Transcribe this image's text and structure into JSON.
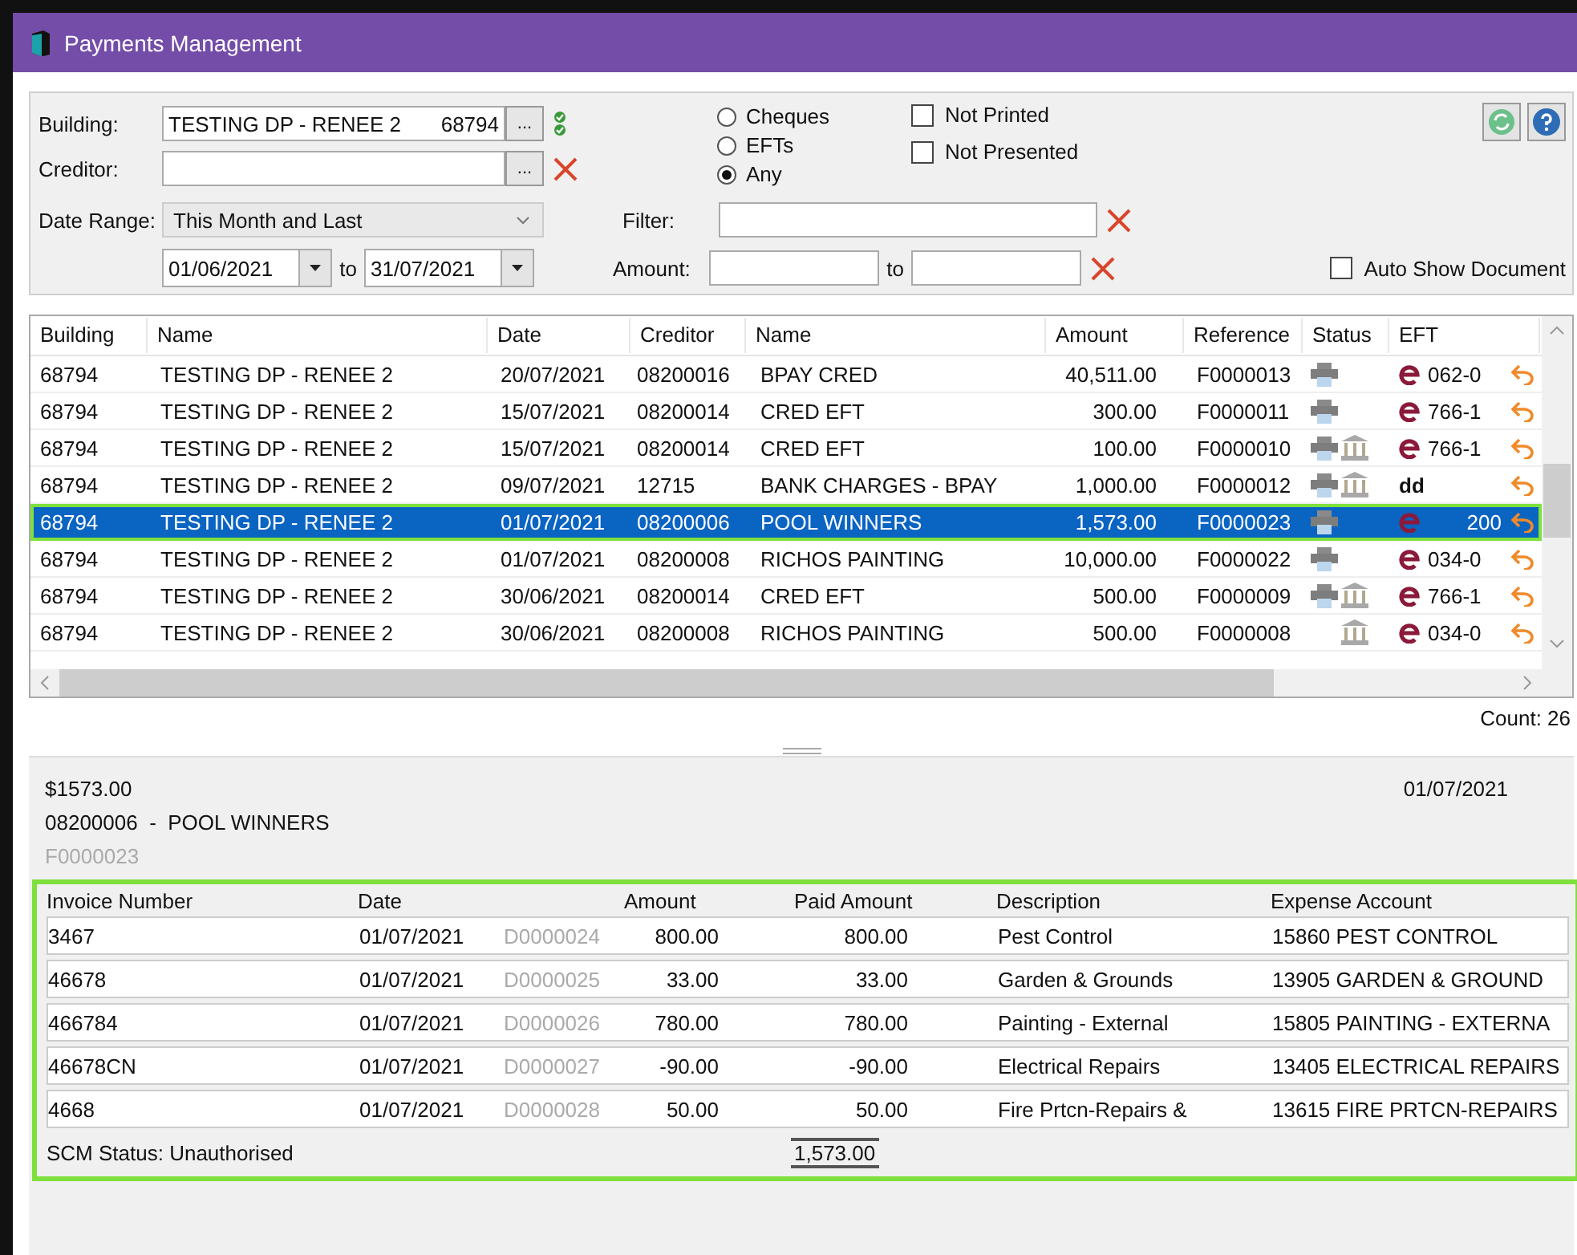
{
  "window": {
    "title": "Payments Management"
  },
  "filters": {
    "building": {
      "label": "Building:",
      "value": "TESTING DP - RENEE 2",
      "code": "68794",
      "button": "...",
      "verified": true
    },
    "creditor": {
      "label": "Creditor:",
      "button": "..."
    },
    "date_range": {
      "label": "Date Range:",
      "value": "This Month and Last",
      "from": "01/06/2021",
      "to_label": "to",
      "to": "31/07/2021"
    },
    "payment_type": [
      {
        "label": "Cheques",
        "selected": false
      },
      {
        "label": "EFTs",
        "selected": false
      },
      {
        "label": "Any",
        "selected": true
      }
    ],
    "flags": [
      {
        "label": "Not Printed",
        "checked": false
      },
      {
        "label": "Not Presented",
        "checked": false
      }
    ],
    "filter": {
      "label": "Filter:"
    },
    "amount": {
      "label": "Amount:",
      "to_label": "to"
    },
    "auto_show": {
      "label": "Auto Show Document",
      "checked": false
    }
  },
  "payments": {
    "columns": [
      "Building",
      "Name",
      "Date",
      "Creditor",
      "Name",
      "Amount",
      "Reference",
      "Status",
      "EFT"
    ],
    "rows": [
      {
        "building": "68794",
        "name": "TESTING DP - RENEE 2",
        "date": "20/07/2021",
        "creditor": "08200016",
        "creditor_name": "BPAY CRED",
        "amount": "40,511.00",
        "reference": "F0000013",
        "printed": true,
        "banked": false,
        "kind": "eft",
        "eft": "062-0",
        "selected": false
      },
      {
        "building": "68794",
        "name": "TESTING DP - RENEE 2",
        "date": "15/07/2021",
        "creditor": "08200014",
        "creditor_name": "CRED EFT",
        "amount": "300.00",
        "reference": "F0000011",
        "printed": true,
        "banked": false,
        "kind": "eft",
        "eft": "766-1",
        "selected": false
      },
      {
        "building": "68794",
        "name": "TESTING DP - RENEE 2",
        "date": "15/07/2021",
        "creditor": "08200014",
        "creditor_name": "CRED EFT",
        "amount": "100.00",
        "reference": "F0000010",
        "printed": true,
        "banked": true,
        "kind": "eft",
        "eft": "766-1",
        "selected": false
      },
      {
        "building": "68794",
        "name": "TESTING DP - RENEE 2",
        "date": "09/07/2021",
        "creditor": "12715",
        "creditor_name": "BANK CHARGES - BPAY",
        "amount": "1,000.00",
        "reference": "F0000012",
        "printed": true,
        "banked": true,
        "kind": "direct_debit",
        "eft": "dd",
        "selected": false
      },
      {
        "building": "68794",
        "name": "TESTING DP - RENEE 2",
        "date": "01/07/2021",
        "creditor": "08200006",
        "creditor_name": "POOL WINNERS",
        "amount": "1,573.00",
        "reference": "F0000023",
        "printed": true,
        "banked": false,
        "kind": "eft",
        "eft": "200",
        "selected": true
      },
      {
        "building": "68794",
        "name": "TESTING DP - RENEE 2",
        "date": "01/07/2021",
        "creditor": "08200008",
        "creditor_name": "RICHOS PAINTING",
        "amount": "10,000.00",
        "reference": "F0000022",
        "printed": true,
        "banked": false,
        "kind": "eft",
        "eft": "034-0",
        "selected": false
      },
      {
        "building": "68794",
        "name": "TESTING DP - RENEE 2",
        "date": "30/06/2021",
        "creditor": "08200014",
        "creditor_name": "CRED EFT",
        "amount": "500.00",
        "reference": "F0000009",
        "printed": true,
        "banked": true,
        "kind": "eft",
        "eft": "766-1",
        "selected": false
      },
      {
        "building": "68794",
        "name": "TESTING DP - RENEE 2",
        "date": "30/06/2021",
        "creditor": "08200008",
        "creditor_name": "RICHOS PAINTING",
        "amount": "500.00",
        "reference": "F0000008",
        "printed": false,
        "banked": true,
        "kind": "eft",
        "eft": "034-0",
        "selected": false
      }
    ],
    "count": "Count: 26"
  },
  "detail": {
    "amount": "$1573.00",
    "creditor": "08200006  -  POOL WINNERS",
    "reference": "F0000023",
    "date": "01/07/2021",
    "columns": [
      "Invoice Number",
      "Date",
      "Amount",
      "Paid Amount",
      "Description",
      "Expense Account"
    ],
    "invoices": [
      {
        "invoice": "3467",
        "date": "01/07/2021",
        "doc": "D0000024",
        "amount": "800.00",
        "paid": "800.00",
        "description": "Pest Control",
        "account": "15860 PEST CONTROL"
      },
      {
        "invoice": "46678",
        "date": "01/07/2021",
        "doc": "D0000025",
        "amount": "33.00",
        "paid": "33.00",
        "description": "Garden & Grounds",
        "account": "13905 GARDEN & GROUND"
      },
      {
        "invoice": "466784",
        "date": "01/07/2021",
        "doc": "D0000026",
        "amount": "780.00",
        "paid": "780.00",
        "description": "Painting - External",
        "account": "15805 PAINTING - EXTERNA"
      },
      {
        "invoice": "46678CN",
        "date": "01/07/2021",
        "doc": "D0000027",
        "amount": "-90.00",
        "paid": "-90.00",
        "description": "Electrical Repairs",
        "account": "13405 ELECTRICAL REPAIRS"
      },
      {
        "invoice": "4668",
        "date": "01/07/2021",
        "doc": "D0000028",
        "amount": "50.00",
        "paid": "50.00",
        "description": "Fire Prtcn-Repairs &",
        "account": "13615 FIRE PRTCN-REPAIRS"
      }
    ],
    "status": "SCM Status: Unauthorised",
    "total": "1,573.00"
  }
}
